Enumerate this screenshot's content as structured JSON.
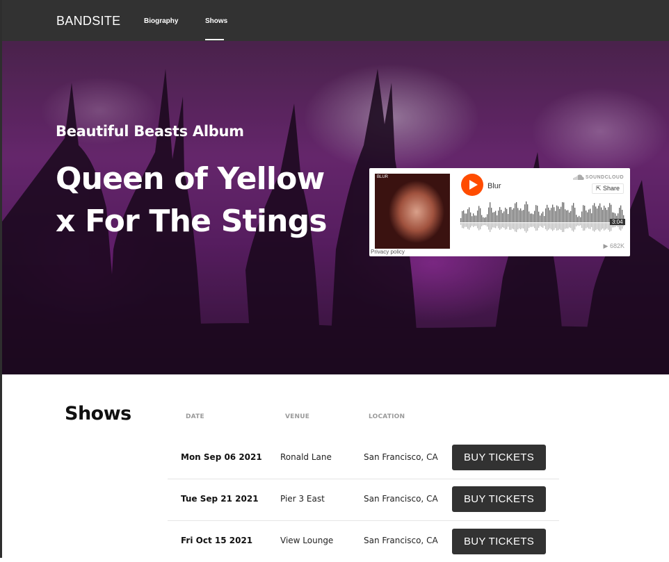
{
  "nav": {
    "logo": "BANDSITE",
    "links": [
      {
        "label": "Biography",
        "active": false
      },
      {
        "label": "Shows",
        "active": true
      }
    ]
  },
  "hero": {
    "subtitle": "Beautiful Beasts Album",
    "title": "Queen of Yellow x For The Stings"
  },
  "soundcloud": {
    "track": "Blur",
    "brand": "SOUNDCLOUD",
    "share_label": "Share",
    "duration": "3:04",
    "plays": "682K",
    "privacy": "Privacy policy",
    "art_label": "BLUR",
    "accent_color": "#ff4c00"
  },
  "shows": {
    "title": "Shows",
    "columns": [
      "DATE",
      "VENUE",
      "LOCATION"
    ],
    "button_label": "BUY TICKETS",
    "rows": [
      {
        "date": "Mon Sep 06 2021",
        "venue": "Ronald Lane",
        "location": "San Francisco, CA"
      },
      {
        "date": "Tue Sep 21 2021",
        "venue": "Pier 3 East",
        "location": "San Francisco, CA"
      },
      {
        "date": "Fri Oct 15 2021",
        "venue": "View Lounge",
        "location": "San Francisco, CA"
      }
    ]
  }
}
